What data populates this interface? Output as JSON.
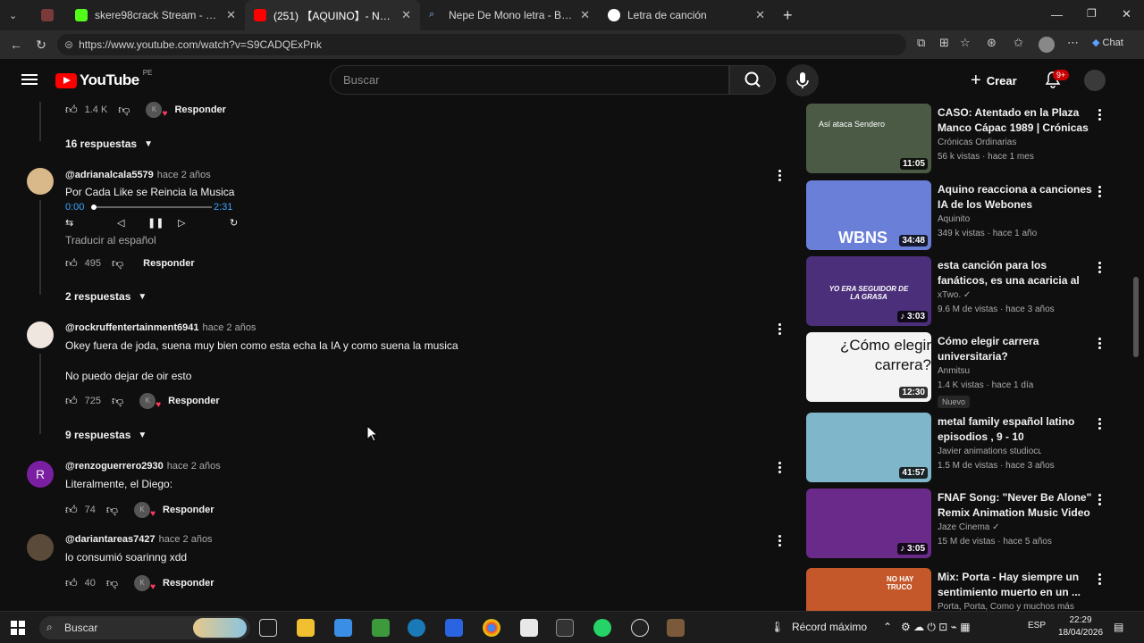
{
  "browser": {
    "tabs": [
      {
        "label": "",
        "color": "#7a3a3a"
      },
      {
        "label": "skere98crack Stream - Watch Live",
        "color": "#53fc18"
      },
      {
        "label": "(251) 【AQUINO】- Nepe De Mono",
        "color": "#ff0000"
      },
      {
        "label": "Nepe De Mono letra - Búsqueda",
        "color": "#4f6bed"
      },
      {
        "label": "Letra de canción",
        "color": "#ffffff"
      }
    ],
    "url": "https://www.youtube.com/watch?v=S9CADQExPnk",
    "chat_label": "Chat"
  },
  "yt": {
    "region": "PE",
    "logo_text": "YouTube",
    "search_placeholder": "Buscar",
    "create_label": "Crear",
    "notif_badge": "9+"
  },
  "comments": {
    "top_like_count": "1.4 K",
    "responder": "Responder",
    "items": [
      {
        "replies_label": "16 respuestas",
        "user": "@adrianalcala5579",
        "time": "hace 2 años",
        "text": "Por Cada Like se Reincia la Musica",
        "player_current": "0:00",
        "player_total": "2:31",
        "player_progress": 0.0,
        "translate": "Traducir al español",
        "likes": "495"
      },
      {
        "replies_label": "2 respuestas",
        "user": "@rockruffentertainment6941",
        "time": "hace 2 años",
        "text": "Okey fuera de joda, suena muy bien como esta echa la IA y como suena la musica",
        "text2": "No puedo dejar de oir esto",
        "likes": "725"
      },
      {
        "replies_label": "9 respuestas",
        "user": "@renzoguerrero2930",
        "time": "hace 2 años",
        "text": "Literalmente, el Diego:",
        "likes": "74",
        "avatar_letter": "R"
      },
      {
        "user": "@dariantareas7427",
        "time": "hace 2 años",
        "text": "lo consumió soarinng xdd",
        "likes": "40"
      }
    ]
  },
  "sidebar": {
    "videos": [
      {
        "title": "CASO: Atentado en la Plaza Manco Cápac 1989 | Crónicas ...",
        "channel": "Crónicas Ordinarias",
        "meta": "56 k vistas · hace 1 mes",
        "duration": "11:05",
        "thumb_text": "Así ataca Sendero",
        "bg": "#4a5a44"
      },
      {
        "title": "Aquino reacciona a canciones IA de los Webones",
        "channel": "Aquinito",
        "meta": "349 k vistas · hace 1 año",
        "duration": "34:48",
        "thumb_text": "WBNS",
        "bg": "#6a7fd8"
      },
      {
        "title": "esta canción para los fanáticos, es una acaricia al alma",
        "channel": "xTwo.",
        "meta": "9.6 M de vistas · hace 3 años",
        "duration": "3:03",
        "thumb_text": "YO ERA SEGUIDOR DE LA GRASA",
        "bg": "#4b2f7a"
      },
      {
        "title": "Cómo elegir carrera universitaria?",
        "channel": "Anmitsu",
        "meta": "1.4 K vistas · hace 1 día",
        "duration": "12:30",
        "thumb_text": "¿Cómo elegir carrera?",
        "bg": "#f4f4f4",
        "new_label": "Nuevo"
      },
      {
        "title": "metal family español latino episodios , 9 - 10",
        "channel": "Javier animations studioᴄʟ",
        "meta": "1.5 M de vistas · hace 3 años",
        "duration": "41:57",
        "thumb_text": "",
        "bg": "#7fb6c9"
      },
      {
        "title": "FNAF Song: \"Never Be Alone\" Remix Animation Music Video ...",
        "channel": "Jaze Cinema",
        "meta": "15 M de vistas · hace 5 años",
        "duration": "3:05",
        "thumb_text": "",
        "bg": "#6a2a8a"
      },
      {
        "title": "Mix: Porta - Hay siempre un sentimiento muerto en un ...",
        "channel": "Porta, Porta, Como y muchos más",
        "meta": "",
        "duration": "",
        "thumb_text": "NO HAY TRUCO",
        "bg": "#c4582a"
      }
    ]
  },
  "taskbar": {
    "search_label": "Buscar",
    "weather_label": "Récord máximo",
    "lang": "ESP",
    "time": "22:29",
    "date": "18/04/2026"
  }
}
